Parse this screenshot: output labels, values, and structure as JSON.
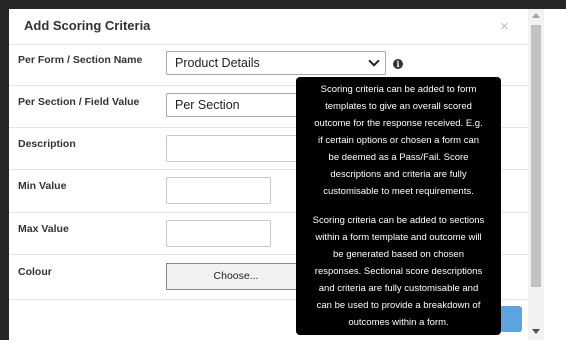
{
  "modal": {
    "title": "Add Scoring Criteria",
    "close_glyph": "×"
  },
  "fields": {
    "per_form": {
      "label": "Per Form / Section Name",
      "value": "Product Details"
    },
    "per_section": {
      "label": "Per Section / Field Value",
      "value": "Per Section"
    },
    "description": {
      "label": "Description",
      "value": ""
    },
    "min_value": {
      "label": "Min Value",
      "value": ""
    },
    "max_value": {
      "label": "Max Value",
      "value": ""
    },
    "colour": {
      "label": "Colour",
      "button_label": "Choose..."
    }
  },
  "info_glyph": "i",
  "tooltip": {
    "lines_1": [
      "Scoring criteria can be added to form",
      "templates to give an overall scored",
      "outcome for the response received. E.g.",
      "if certain options or chosen a form can",
      "be deemed as a Pass/Fail. Score",
      "descriptions and criteria are fully",
      "customisable to meet requirements."
    ],
    "lines_2": [
      "Scoring criteria can be added to sections",
      "within a form template and outcome will",
      "be generated based on chosen",
      "responses. Sectional score descriptions",
      "and criteria are fully customisable and",
      "can be used to provide a breakdown of",
      "outcomes within a form."
    ]
  },
  "icons": {
    "info": "info-icon",
    "close": "close-icon",
    "dropdown": "chevron-down-icon",
    "scroll_up": "scroll-up-arrow-icon",
    "scroll_down": "scroll-down-arrow-icon"
  },
  "colors": {
    "backdrop": "#262626",
    "tooltip_bg": "#000000",
    "primary_button": "#5ba4e0"
  }
}
